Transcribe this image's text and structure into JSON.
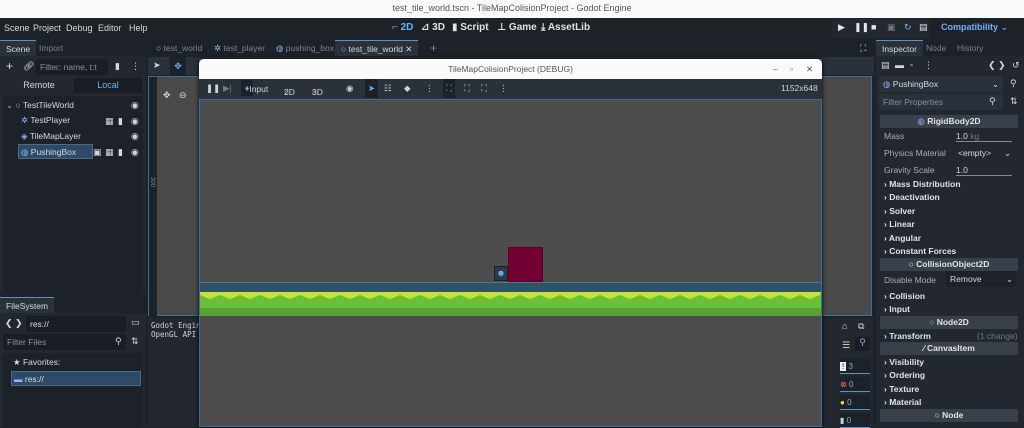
{
  "window": {
    "title": "test_tile_world.tscn - TileMapColisionProject - Godot Engine"
  },
  "menu": [
    "Scene",
    "Project",
    "Debug",
    "Editor",
    "Help"
  ],
  "main_screens": [
    "2D",
    "3D",
    "Script",
    "Game",
    "AssetLib"
  ],
  "renderer": "Compatibility",
  "scene_dock": {
    "tabs": [
      "Scene",
      "Import"
    ],
    "filter_placeholder": "Filter: name, t:t",
    "modes": [
      "Remote",
      "Local"
    ],
    "tree": [
      {
        "name": "TestTileWorld",
        "icon": "node2d-icon"
      },
      {
        "name": "TestPlayer",
        "icon": "character-icon"
      },
      {
        "name": "TileMapLayer",
        "icon": "tilemap-icon"
      },
      {
        "name": "PushingBox",
        "icon": "rigidbody-icon",
        "selected": true
      }
    ]
  },
  "editor_tabs": [
    "test_world",
    "test_player",
    "pushing_box",
    "test_tile_world"
  ],
  "ruler_label": "300",
  "output": {
    "lines": [
      "Godot Engin",
      "OpenGL API :"
    ]
  },
  "filesystem": {
    "tab": "FileSystem",
    "path": "res://",
    "filter_placeholder": "Filter Files",
    "favorites": "Favorites:",
    "root": "res://"
  },
  "debug_window": {
    "title": "TileMapColisionProject (DEBUG)",
    "input_label": "Input",
    "mode_2d": "2D",
    "mode_3d": "3D",
    "resolution": "1152x648"
  },
  "counters": {
    "messages": "3",
    "errors": "0",
    "warnings": "0",
    "debug": "0"
  },
  "inspector": {
    "tabs": [
      "Inspector",
      "Node",
      "History"
    ],
    "object": "PushingBox",
    "filter_placeholder": "Filter Properties",
    "rigidbody": "RigidBody2D",
    "mass": "1.0",
    "mass_unit": "kg",
    "physics_material_label": "Physics Material",
    "physics_material": "<empty>",
    "gravity_label": "Gravity Scale",
    "gravity": "1.0",
    "mass_label": "Mass",
    "groups1": [
      "Mass Distribution",
      "Deactivation",
      "Solver",
      "Linear",
      "Angular",
      "Constant Forces"
    ],
    "collision": "CollisionObject2D",
    "disable_label": "Disable Mode",
    "disable_value": "Remove",
    "groups2": [
      "Collision",
      "Input"
    ],
    "node2d": "Node2D",
    "transform": "Transform",
    "transform_note": "(1 change)",
    "canvasitem": "CanvasItem",
    "groups3": [
      "Visibility",
      "Ordering",
      "Texture",
      "Material"
    ],
    "node": "Node"
  },
  "colors": {
    "accent": "#5b8fce",
    "box": "#730033",
    "ground_top": "#2e5266",
    "grass": "#6cbf3a"
  }
}
